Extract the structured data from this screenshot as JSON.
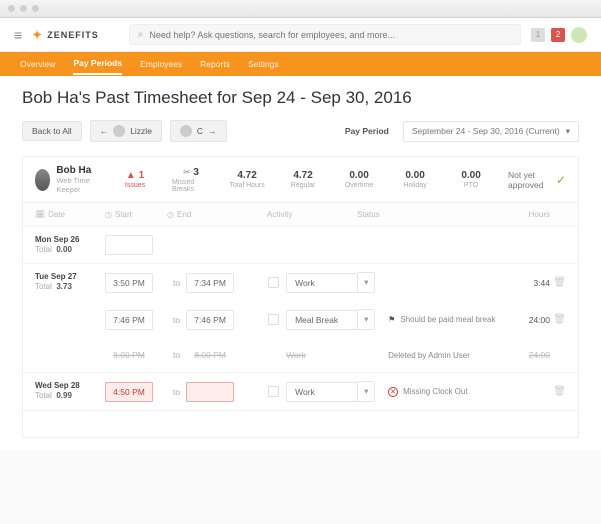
{
  "topbar": {
    "brand": "ZENEFITS",
    "search_placeholder": "Need help? Ask questions, search for employees, and more...",
    "notif1": "1",
    "notif2": "2"
  },
  "nav": {
    "items": [
      "Overview",
      "Pay Periods",
      "Employees",
      "Reports",
      "Settings"
    ],
    "active_index": 1
  },
  "title": "Bob Ha's Past Timesheet for Sep 24 - Sep 30, 2016",
  "controls": {
    "back": "Back to All",
    "prev_emp": "Lizzle",
    "next_emp": "C",
    "pp_label": "Pay Period",
    "pp_value": "September 24 - Sep 30, 2016 (Current)"
  },
  "employee": {
    "name": "Bob Ha",
    "role": "Web Time Keeper"
  },
  "stats": {
    "issues_v": "1",
    "issues_l": "Issues",
    "mb_v": "3",
    "mb_l": "Missed Breaks",
    "th_v": "4.72",
    "th_l": "Total Hours",
    "reg_v": "4.72",
    "reg_l": "Regular",
    "ot_v": "0.00",
    "ot_l": "Overtime",
    "hol_v": "0.00",
    "hol_l": "Holiday",
    "pto_v": "0.00",
    "pto_l": "PTO"
  },
  "approval": "Not yet approved",
  "thead": {
    "date": "Date",
    "start": "Start",
    "end": "End",
    "activity": "Activity",
    "status": "Status",
    "hours": "Hours"
  },
  "days": {
    "mon": {
      "label": "Mon Sep 26",
      "total_l": "Total",
      "total_v": "0.00"
    },
    "tue": {
      "label": "Tue Sep 27",
      "total_l": "Total",
      "total_v": "3.73"
    },
    "wed": {
      "label": "Wed Sep 28",
      "total_l": "Total",
      "total_v": "0.99"
    }
  },
  "rows": {
    "to": "to",
    "tue1": {
      "start": "3:50 PM",
      "end": "7:34 PM",
      "activity": "Work",
      "hours": "3:44"
    },
    "tue2": {
      "start": "7:46 PM",
      "end": "7:46 PM",
      "activity": "Meal Break",
      "status": "Should be paid meal break",
      "hours": "24:00"
    },
    "tue3": {
      "start": "8:00 PM",
      "end": "8:00 PM",
      "activity": "Work",
      "status": "Deleted by Admin User",
      "hours": "24:00"
    },
    "wed1": {
      "start": "4:50 PM",
      "end": "",
      "activity": "Work",
      "status": "Missing Clock Out",
      "hours": ""
    }
  }
}
